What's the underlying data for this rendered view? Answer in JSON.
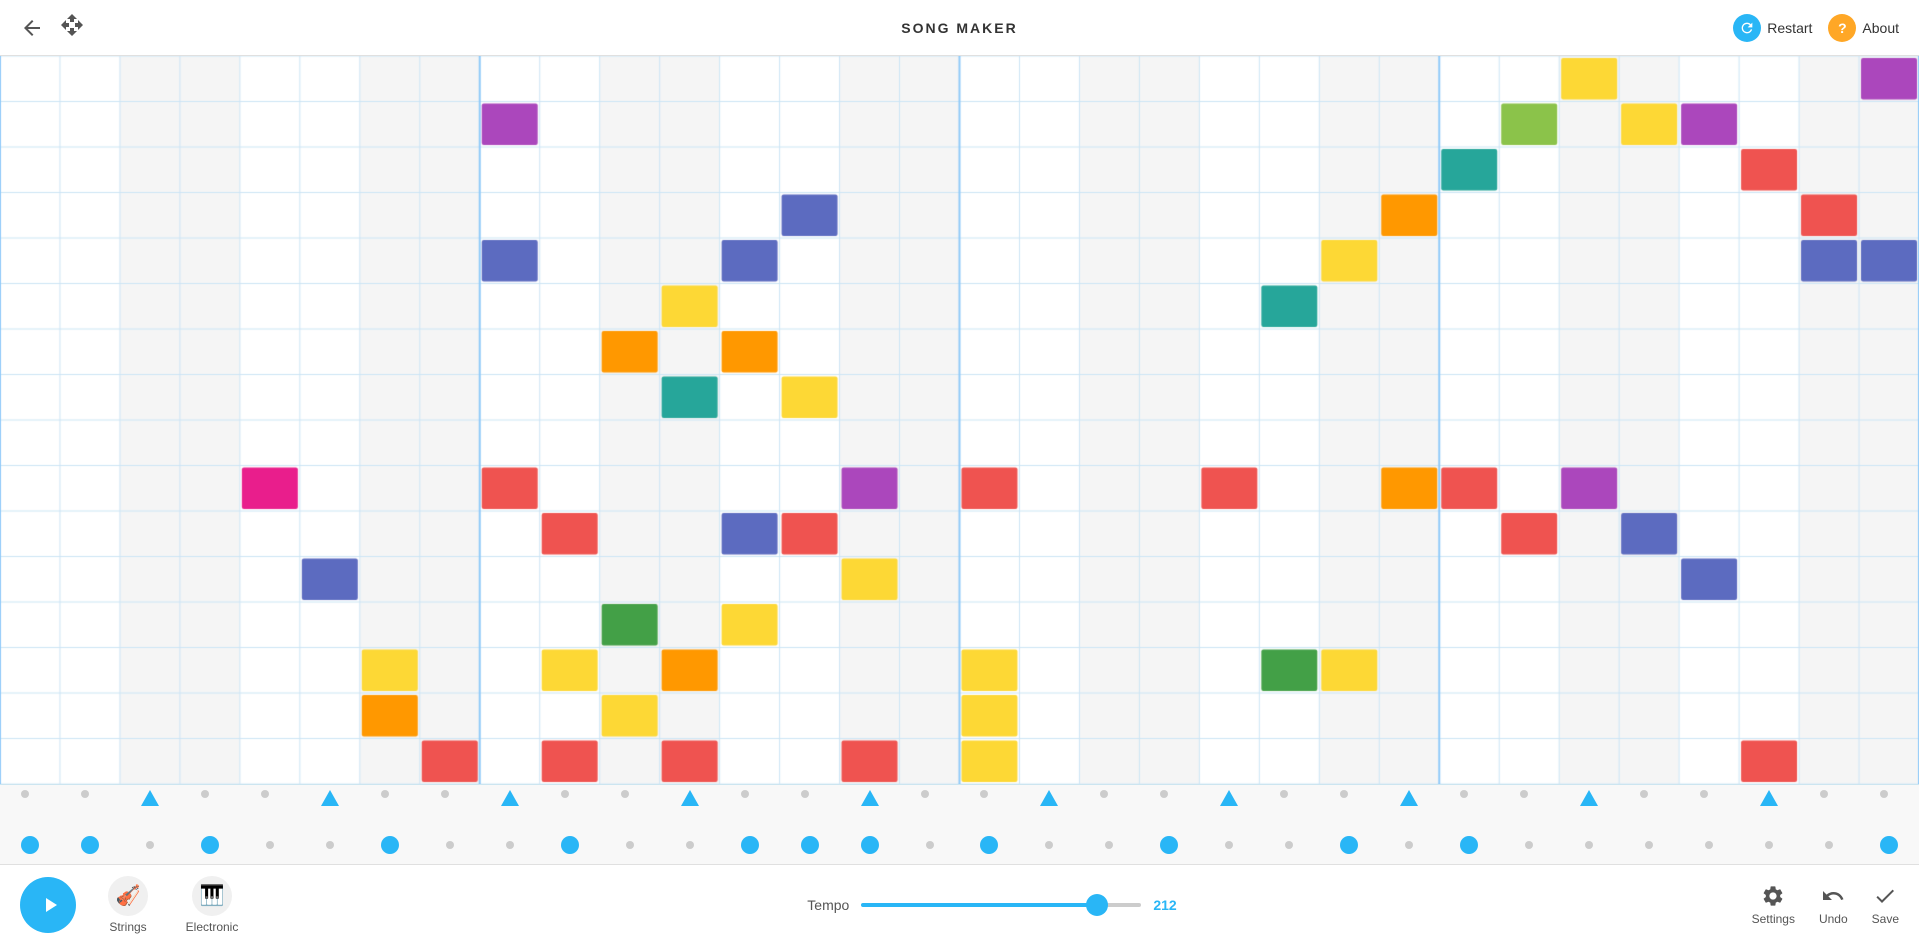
{
  "header": {
    "title": "SONG MAKER",
    "back_label": "←",
    "move_label": "⤢",
    "restart_label": "Restart",
    "about_label": "About"
  },
  "footer": {
    "play_label": "Play",
    "instruments": [
      {
        "id": "strings",
        "label": "Strings",
        "icon": "🎻"
      },
      {
        "id": "electronic",
        "label": "Electronic",
        "icon": "🎹"
      }
    ],
    "tempo_label": "Tempo",
    "tempo_value": "212",
    "actions": [
      {
        "id": "settings",
        "label": "Settings",
        "icon": "settings"
      },
      {
        "id": "undo",
        "label": "Undo",
        "icon": "undo"
      },
      {
        "id": "save",
        "label": "Save",
        "icon": "save"
      }
    ]
  },
  "grid": {
    "cols": 32,
    "melody_rows": 16,
    "accent_color": "#29b6f6",
    "notes": [
      {
        "col": 4,
        "row": 9,
        "color": "#e91e8c"
      },
      {
        "col": 5,
        "row": 11,
        "color": "#5c6bc0"
      },
      {
        "col": 6,
        "row": 13,
        "color": "#fdd835"
      },
      {
        "col": 6,
        "row": 14,
        "color": "#ff9800"
      },
      {
        "col": 7,
        "row": 15,
        "color": "#ef5350"
      },
      {
        "col": 8,
        "row": 1,
        "color": "#ab47bc"
      },
      {
        "col": 8,
        "row": 4,
        "color": "#5c6bc0"
      },
      {
        "col": 8,
        "row": 9,
        "color": "#ef5350"
      },
      {
        "col": 9,
        "row": 10,
        "color": "#ef5350"
      },
      {
        "col": 9,
        "row": 13,
        "color": "#fdd835"
      },
      {
        "col": 9,
        "row": 15,
        "color": "#ef5350"
      },
      {
        "col": 10,
        "row": 6,
        "color": "#ff9800"
      },
      {
        "col": 10,
        "row": 12,
        "color": "#43a047"
      },
      {
        "col": 10,
        "row": 14,
        "color": "#fdd835"
      },
      {
        "col": 11,
        "row": 5,
        "color": "#fdd835"
      },
      {
        "col": 11,
        "row": 7,
        "color": "#26a69a"
      },
      {
        "col": 11,
        "row": 13,
        "color": "#ff9800"
      },
      {
        "col": 11,
        "row": 15,
        "color": "#ef5350"
      },
      {
        "col": 12,
        "row": 4,
        "color": "#5c6bc0"
      },
      {
        "col": 12,
        "row": 6,
        "color": "#ff9800"
      },
      {
        "col": 12,
        "row": 10,
        "color": "#5c6bc0"
      },
      {
        "col": 12,
        "row": 12,
        "color": "#fdd835"
      },
      {
        "col": 13,
        "row": 3,
        "color": "#5c6bc0"
      },
      {
        "col": 13,
        "row": 7,
        "color": "#fdd835"
      },
      {
        "col": 13,
        "row": 10,
        "color": "#ef5350"
      },
      {
        "col": 14,
        "row": 9,
        "color": "#ab47bc"
      },
      {
        "col": 14,
        "row": 11,
        "color": "#fdd835"
      },
      {
        "col": 14,
        "row": 15,
        "color": "#ef5350"
      },
      {
        "col": 16,
        "row": 9,
        "color": "#ef5350"
      },
      {
        "col": 16,
        "row": 13,
        "color": "#fdd835"
      },
      {
        "col": 16,
        "row": 14,
        "color": "#fdd835"
      },
      {
        "col": 16,
        "row": 15,
        "color": "#fdd835"
      },
      {
        "col": 20,
        "row": 9,
        "color": "#ef5350"
      },
      {
        "col": 21,
        "row": 5,
        "color": "#26a69a"
      },
      {
        "col": 21,
        "row": 13,
        "color": "#43a047"
      },
      {
        "col": 22,
        "row": 4,
        "color": "#fdd835"
      },
      {
        "col": 22,
        "row": 13,
        "color": "#fdd835"
      },
      {
        "col": 23,
        "row": 3,
        "color": "#ff9800"
      },
      {
        "col": 23,
        "row": 9,
        "color": "#ff9800"
      },
      {
        "col": 24,
        "row": 2,
        "color": "#26a69a"
      },
      {
        "col": 24,
        "row": 9,
        "color": "#ef5350"
      },
      {
        "col": 25,
        "row": 1,
        "color": "#8bc34a"
      },
      {
        "col": 25,
        "row": 10,
        "color": "#ef5350"
      },
      {
        "col": 26,
        "row": 0,
        "color": "#fdd835"
      },
      {
        "col": 26,
        "row": 9,
        "color": "#ab47bc"
      },
      {
        "col": 27,
        "row": 1,
        "color": "#fdd835"
      },
      {
        "col": 27,
        "row": 10,
        "color": "#5c6bc0"
      },
      {
        "col": 28,
        "row": 1,
        "color": "#ab47bc"
      },
      {
        "col": 28,
        "row": 11,
        "color": "#5c6bc0"
      },
      {
        "col": 29,
        "row": 2,
        "color": "#ef5350"
      },
      {
        "col": 29,
        "row": 15,
        "color": "#ef5350"
      },
      {
        "col": 30,
        "row": 3,
        "color": "#ef5350"
      },
      {
        "col": 30,
        "row": 4,
        "color": "#5c6bc0"
      },
      {
        "col": 31,
        "row": 0,
        "color": "#ab47bc"
      },
      {
        "col": 31,
        "row": 4,
        "color": "#5c6bc0"
      }
    ],
    "percussion_row1": [
      2,
      5,
      8,
      11,
      14,
      17,
      20,
      23,
      26,
      29
    ],
    "percussion_row2": [
      0,
      1,
      3,
      6,
      9,
      12,
      13,
      14,
      16,
      19,
      22,
      24,
      31
    ],
    "triangles": [
      2,
      5,
      8,
      11,
      14,
      17,
      20,
      23,
      26,
      29
    ]
  }
}
